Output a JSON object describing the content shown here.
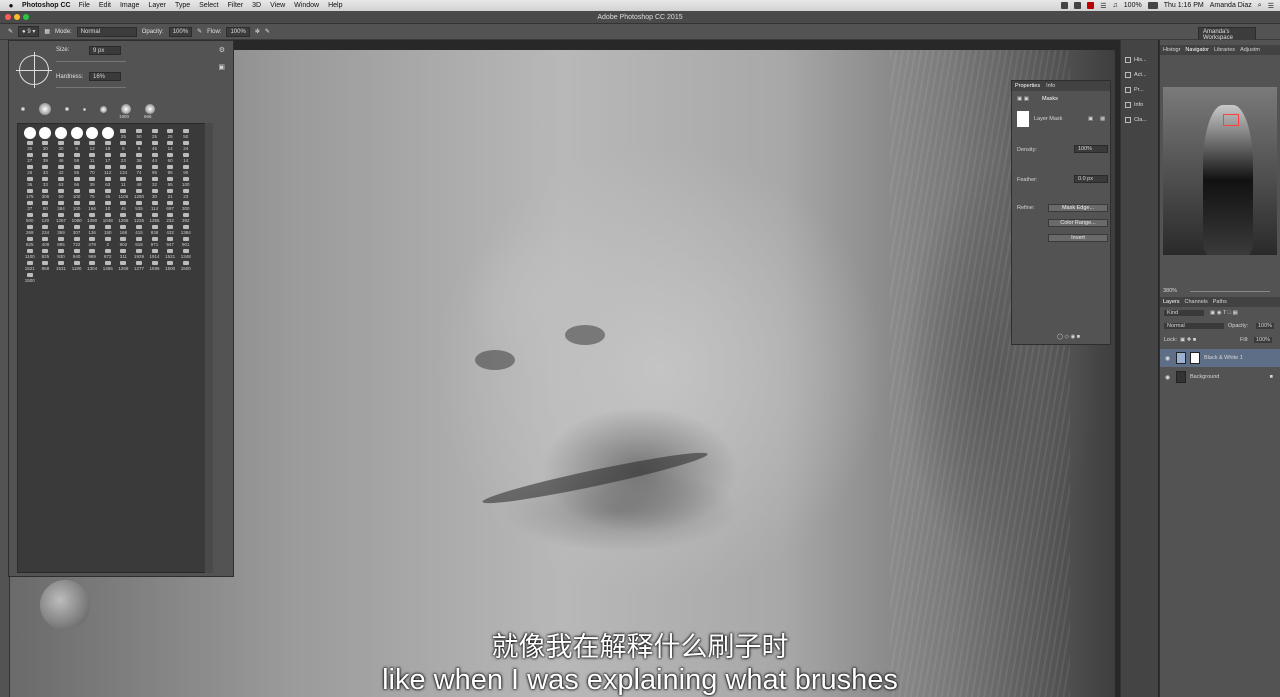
{
  "menubar": {
    "app": "Photoshop CC",
    "items": [
      "File",
      "Edit",
      "Image",
      "Layer",
      "Type",
      "Select",
      "Filter",
      "3D",
      "View",
      "Window",
      "Help"
    ],
    "battery": "100%",
    "clock": "Thu 1:16 PM",
    "user": "Amanda Diaz"
  },
  "window": {
    "title": "Adobe Photoshop CC 2015"
  },
  "options": {
    "mode_label": "Mode:",
    "mode_value": "Normal",
    "opacity_label": "Opacity:",
    "opacity_value": "100%",
    "flow_label": "Flow:",
    "flow_value": "100%",
    "workspace": "Amanda's Workspace"
  },
  "brush_panel": {
    "size_label": "Size:",
    "size_value": "9 px",
    "hardness_label": "Hardness:",
    "hardness_value": "16%",
    "recent_sizes": [
      "1800",
      "666"
    ],
    "preset_sizes": [
      "25",
      "50",
      "25",
      "25",
      "50",
      "30",
      "30",
      "30",
      "9",
      "13",
      "19",
      "5",
      "9",
      "45",
      "14",
      "24",
      "27",
      "39",
      "46",
      "59",
      "11",
      "17",
      "23",
      "36",
      "44",
      "60",
      "14",
      "26",
      "33",
      "42",
      "55",
      "70",
      "112",
      "134",
      "74",
      "95",
      "95",
      "90",
      "36",
      "33",
      "63",
      "66",
      "39",
      "63",
      "11",
      "48",
      "32",
      "55",
      "100",
      "175",
      "306",
      "50",
      "100",
      "75",
      "45",
      "1106",
      "1280",
      "30",
      "21",
      "23",
      "37",
      "80",
      "384",
      "100",
      "166",
      "10",
      "45",
      "535",
      "114",
      "697",
      "300",
      "500",
      "120",
      "1267",
      "1080",
      "1390",
      "1048",
      "1265",
      "1226",
      "1355",
      "232",
      "392",
      "269",
      "234",
      "369",
      "307",
      "136",
      "150",
      "168",
      "415",
      "838",
      "432",
      "1384",
      "825",
      "409",
      "895",
      "722",
      "479",
      "2",
      "902",
      "915",
      "971",
      "947",
      "901",
      "1100",
      "825",
      "930",
      "940",
      "969",
      "872",
      "311",
      "1929",
      "1914",
      "1521",
      "1348",
      "1521",
      "968",
      "1531",
      "1180",
      "1304",
      "1366",
      "1269",
      "1277",
      "1595",
      "1500",
      "1500",
      "1500"
    ]
  },
  "properties": {
    "tabs": [
      "Properties",
      "Info"
    ],
    "section": "Masks",
    "layer_mask": "Layer Mask",
    "density_label": "Density:",
    "density_value": "100%",
    "feather_label": "Feather:",
    "feather_value": "0.0 px",
    "refine_label": "Refine:",
    "buttons": [
      "Mask Edge...",
      "Color Range...",
      "Invert"
    ]
  },
  "dock": {
    "items": [
      "His...",
      "Act...",
      "Pr...",
      "Info",
      "Cla..."
    ]
  },
  "right_panel": {
    "top_tabs": [
      "Histogr",
      "Navigator",
      "Libraries",
      "Adjustm"
    ],
    "zoom": "380%",
    "layer_tabs": [
      "Layers",
      "Channels",
      "Paths"
    ],
    "kind_label": "Kind",
    "blend_mode": "Normal",
    "opacity_label": "Opacity:",
    "opacity_value": "100%",
    "lock_label": "Lock:",
    "fill_label": "Fill:",
    "fill_value": "100%",
    "layers": [
      {
        "name": "Black & White 1"
      },
      {
        "name": "Background"
      }
    ]
  },
  "subtitles": {
    "chinese": "就像我在解释什么刷子时",
    "english": "like when I was explaining what brushes"
  },
  "colors": {
    "panel": "#535353",
    "dark": "#282828",
    "selection": "#5e6e86"
  }
}
